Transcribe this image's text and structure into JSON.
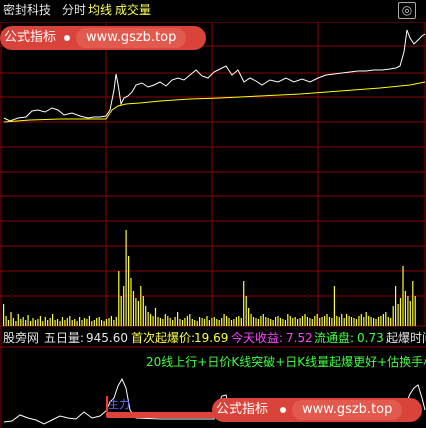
{
  "header": {
    "title": "密封科技",
    "tab_minute": "分时",
    "tab_avg": "均线",
    "tab_volume": "成交量",
    "corner_btn": "◎"
  },
  "watermark": {
    "left_text": "公式指标",
    "url": "www.gszb.top"
  },
  "info_bar": {
    "source": "股旁网",
    "five_day_label": "五日量:",
    "five_day_value": "945.60",
    "first_limit_label": "首次起爆价:",
    "first_limit_value": "19.69",
    "today_gain_label": "今天收益:",
    "today_gain_value": "7.52",
    "float_label": "流通盘:",
    "float_value": "0.73",
    "tail": "起爆时间"
  },
  "formula_text": "20线上行+日价K线突破+日K线量起爆更好+估换手小",
  "indicator_tag": "主力",
  "colors": {
    "background": "#000000",
    "grid": "#8b0000",
    "price_line": "#ffffff",
    "avg_line": "#ffff00",
    "volume": "#ffff33",
    "banner": "#d9433a"
  }
}
